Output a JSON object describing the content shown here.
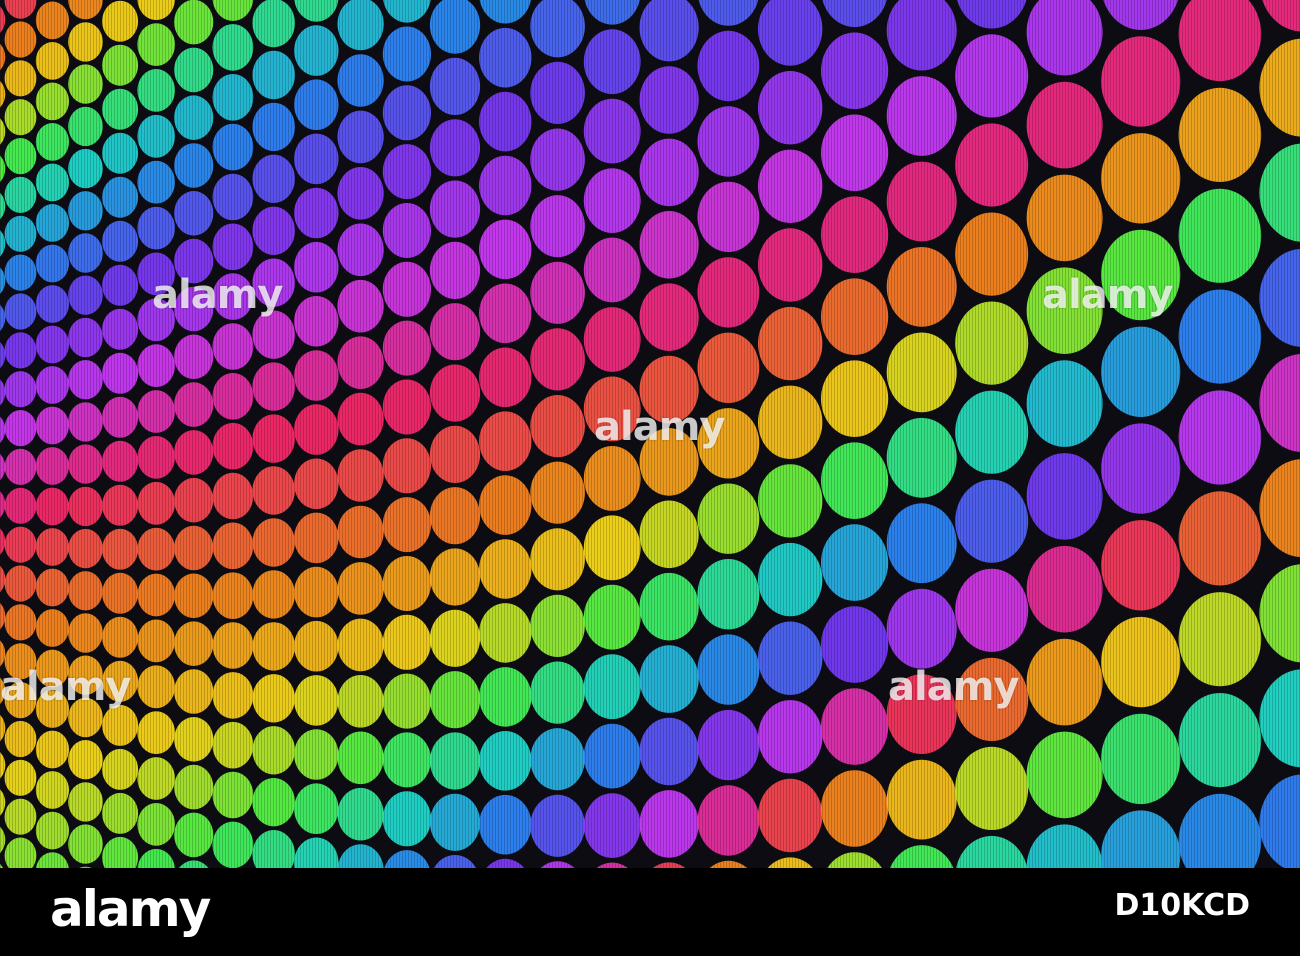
{
  "photo": {
    "subject": "holographic-dot-pattern",
    "background_color": "#0c0c12",
    "palette": [
      "#ff2a6d",
      "#ff8a1f",
      "#ffe21a",
      "#4cff4a",
      "#22e0d2",
      "#2f8bff",
      "#7b3cff",
      "#d23cff"
    ]
  },
  "watermarks": [
    {
      "text": "alamy"
    },
    {
      "text": "alamy"
    },
    {
      "text": "alamy"
    },
    {
      "text": "alamy"
    },
    {
      "text": "alamy"
    }
  ],
  "footer": {
    "logo": "alamy",
    "image_id": "D10KCD"
  }
}
